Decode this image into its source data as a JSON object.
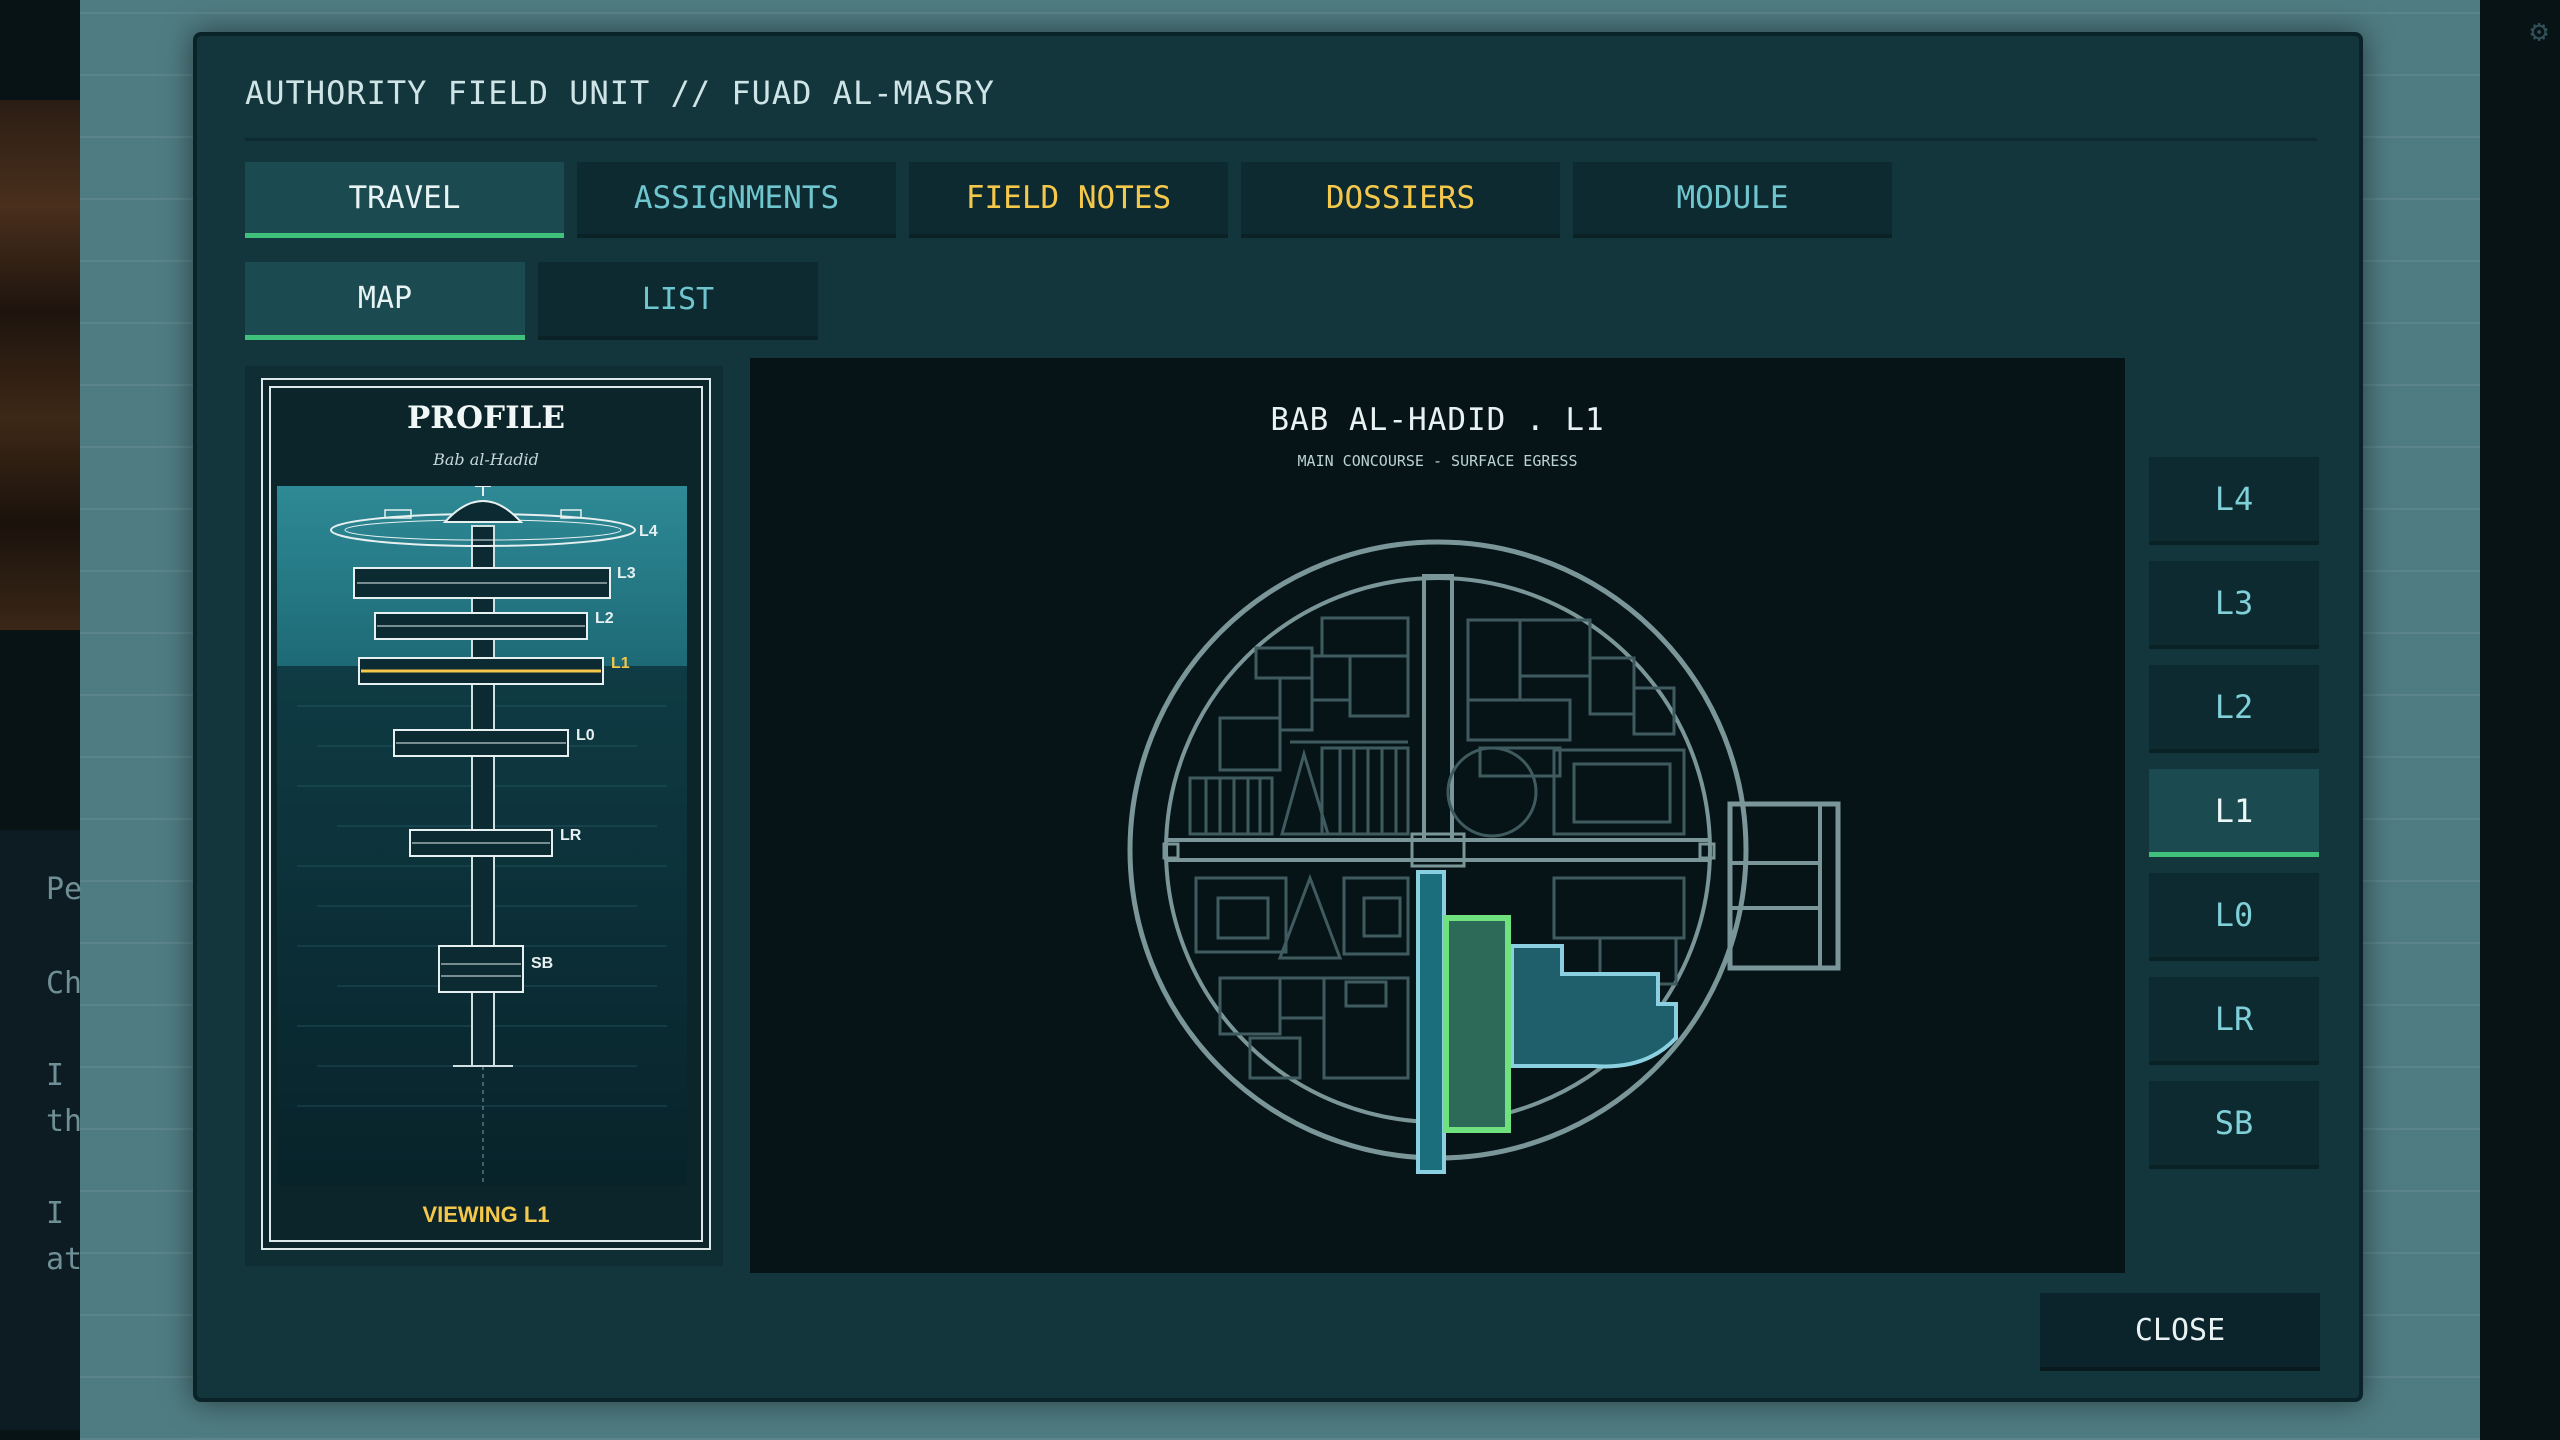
{
  "window": {
    "title": "AUTHORITY FIELD UNIT // FUAD AL-MASRY"
  },
  "tabs": [
    {
      "label": "TRAVEL",
      "active": true
    },
    {
      "label": "ASSIGNMENTS",
      "active": false
    },
    {
      "label": "FIELD NOTES",
      "active": false
    },
    {
      "label": "DOSSIERS",
      "active": false
    },
    {
      "label": "MODULE",
      "active": false
    }
  ],
  "subtabs": [
    {
      "label": "MAP",
      "active": true
    },
    {
      "label": "LIST",
      "active": false
    }
  ],
  "profile": {
    "title": "PROFILE",
    "subtitle": "Bab al-Hadid",
    "levels": [
      "L4",
      "L3",
      "L2",
      "L1",
      "L0",
      "LR",
      "SB"
    ],
    "viewing": "VIEWING L1"
  },
  "map": {
    "title": "BAB AL-HADID . L1",
    "subtitle": "MAIN CONCOURSE - SURFACE EGRESS"
  },
  "level_buttons": [
    "L4",
    "L3",
    "L2",
    "L1",
    "L0",
    "LR",
    "SB"
  ],
  "active_level": "L1",
  "close_label": "CLOSE",
  "background_text": [
    "Pe",
    "Ch",
    "I",
    "th",
    "I",
    "at"
  ],
  "colors": {
    "panel": "#12363c",
    "accent_green": "#3fc07b",
    "accent_yellow": "#f4c84a",
    "accent_cyan": "#6fc6cf",
    "highlight_room": "#6fe27f"
  },
  "icons": {
    "settings": "gear-icon"
  }
}
